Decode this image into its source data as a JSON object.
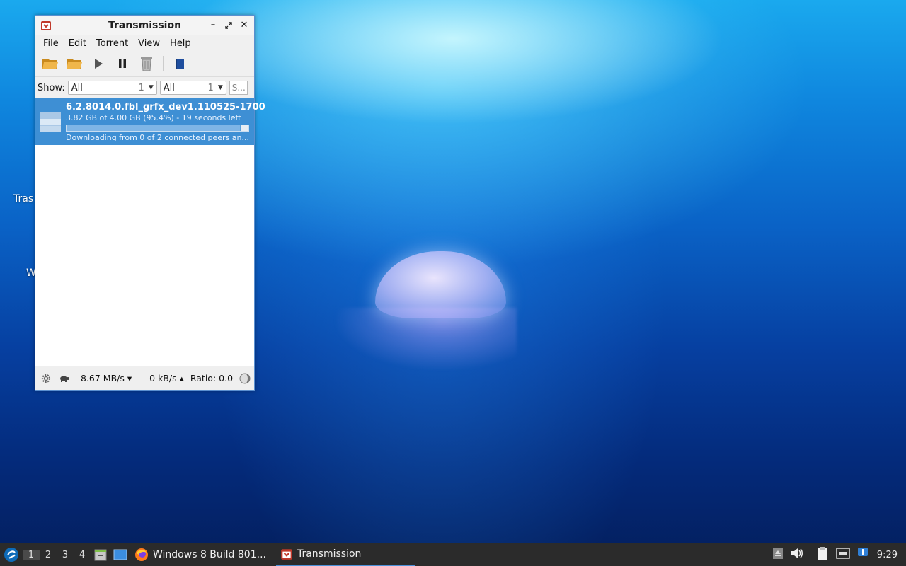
{
  "desktop": {
    "labels": [
      "Tras",
      "W"
    ]
  },
  "window": {
    "title": "Transmission",
    "menu": [
      "File",
      "Edit",
      "Torrent",
      "View",
      "Help"
    ],
    "filter": {
      "show_label": "Show:",
      "combo1": {
        "value": "All",
        "count": "1"
      },
      "combo2": {
        "value": "All",
        "count": "1"
      },
      "search_placeholder": "S..."
    },
    "torrent": {
      "name": "6.2.8014.0.fbl_grfx_dev1.110525-1700",
      "progress_text": "3.82 GB of 4.00 GB (95.4%) - 19 seconds left",
      "progress": 95.4,
      "status": "Downloading from 0 of 2 connected peers an..."
    },
    "statusbar": {
      "down_speed": "8.67 MB/s ▾",
      "up_speed": "0 kB/s ▴",
      "ratio": "Ratio: 0.0"
    }
  },
  "taskbar": {
    "workspaces": [
      "1",
      "2",
      "3",
      "4"
    ],
    "tasks": [
      {
        "label": "Windows 8 Build 801...",
        "icon": "firefox-icon"
      },
      {
        "label": "Transmission",
        "icon": "transmission-icon"
      }
    ],
    "clock": "9:29"
  },
  "colors": {
    "selection": "#3e8fd4",
    "taskbar": "#2b2b2b",
    "active_task_underline": "#4a90d9"
  }
}
